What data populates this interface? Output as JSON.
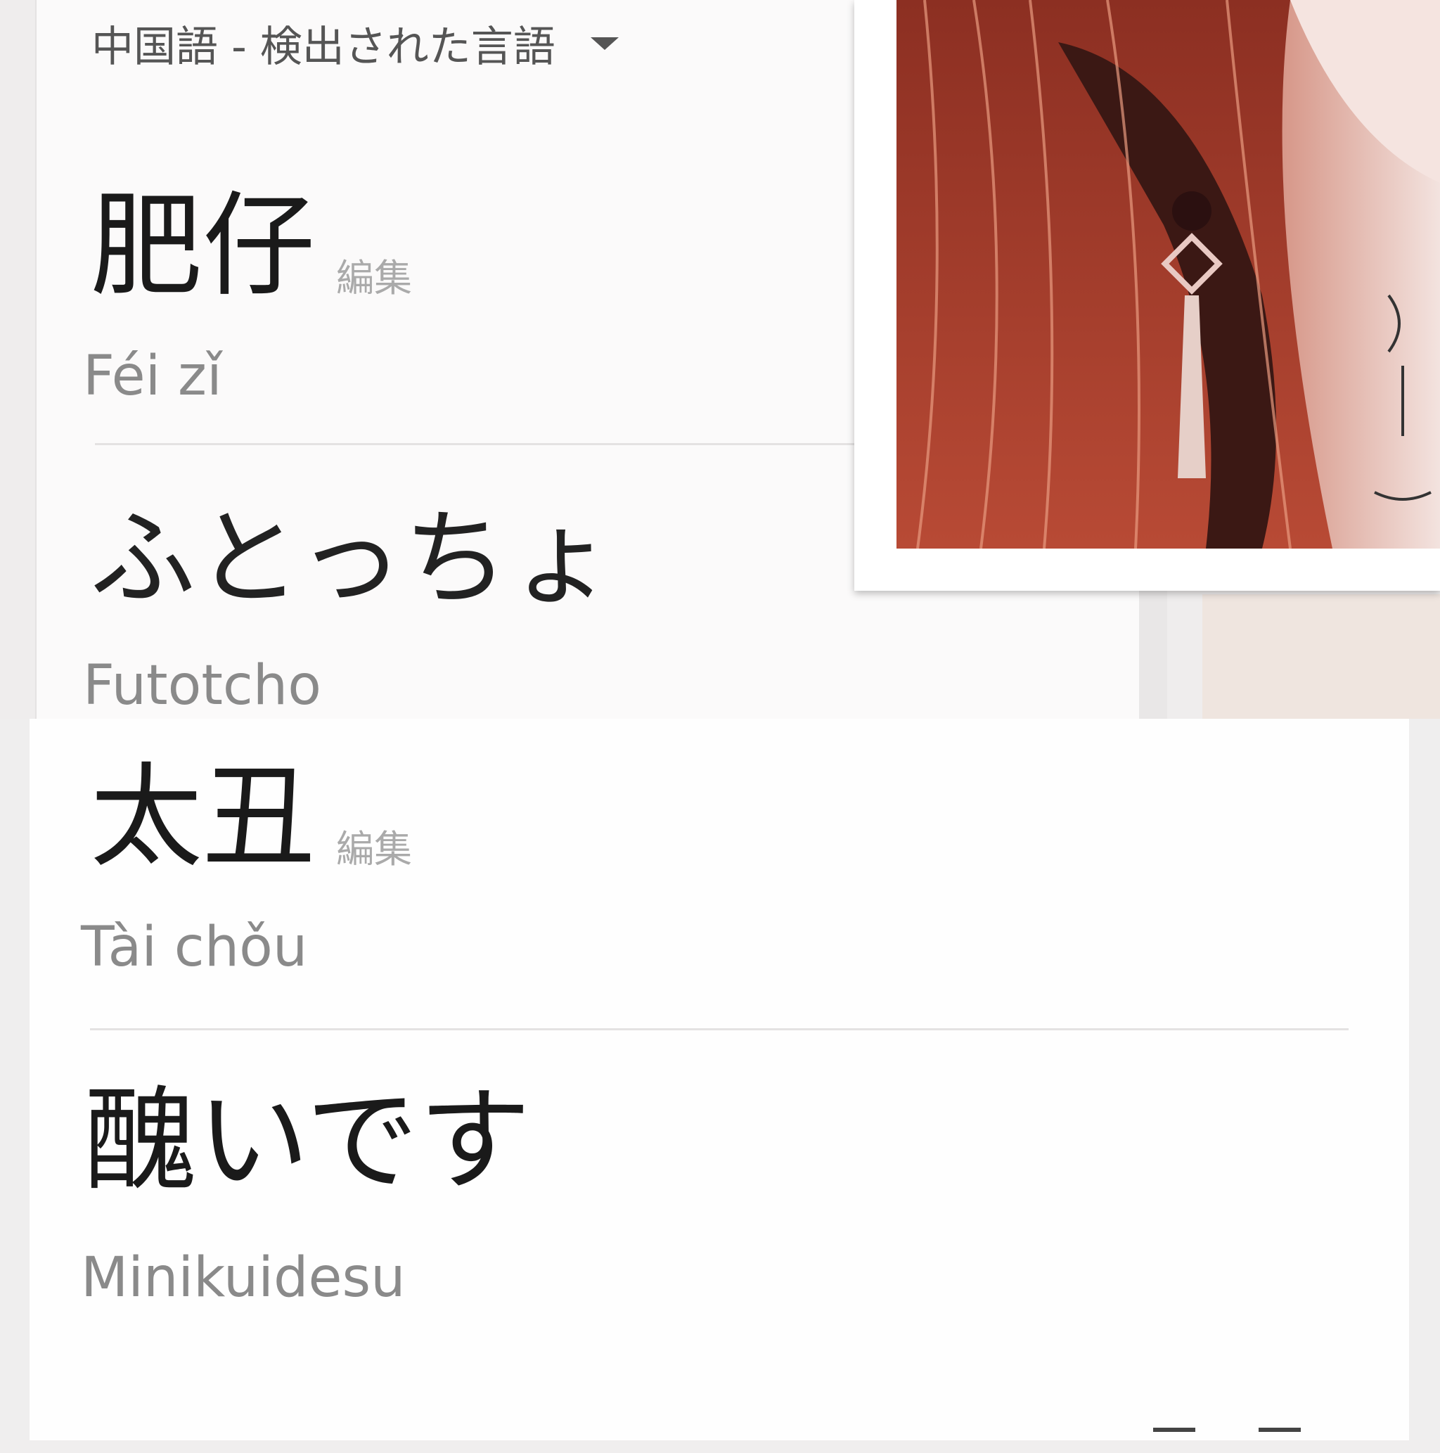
{
  "header": {
    "language_label": "中国語 - 検出された言語"
  },
  "top_entries": [
    {
      "source_text": "肥仔",
      "edit_label": "編集",
      "romanization": "Féi zǐ"
    },
    {
      "translation_text": "ふとっちょ",
      "romanization": "Futotcho"
    }
  ],
  "bottom_entries": [
    {
      "source_text": "太丑",
      "edit_label": "編集",
      "romanization": "Tài chǒu"
    },
    {
      "translation_text": "醜いです",
      "romanization": "Minikuidesu"
    }
  ],
  "icons": {
    "dropdown": "chevron-down-icon"
  },
  "colors": {
    "card_bg": "#fbfafa",
    "text_primary": "#1a1a1a",
    "text_secondary": "#8a8a8a",
    "edit_gray": "#aaaaaa"
  }
}
